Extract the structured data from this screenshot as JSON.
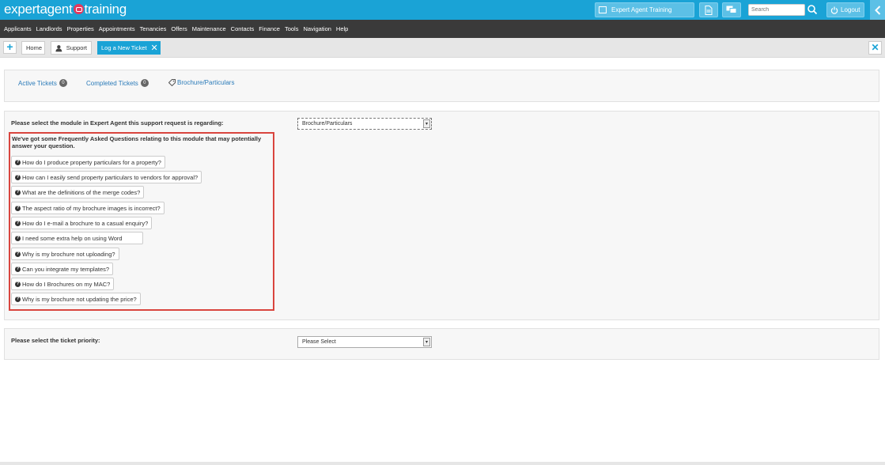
{
  "brand": {
    "logo_left": "expertagent",
    "logo_right": "training",
    "color": "#1aa3d6",
    "accent": "#e2385d"
  },
  "topbar": {
    "site_label": "Expert Agent Training",
    "search_placeholder": "Search",
    "logout_label": "Logout"
  },
  "nav": {
    "items": [
      "Applicants",
      "Landlords",
      "Properties",
      "Appointments",
      "Tenancies",
      "Offers",
      "Maintenance",
      "Contacts",
      "Finance",
      "Tools",
      "Navigation",
      "Help"
    ]
  },
  "tabs": {
    "home": "Home",
    "support": "Support",
    "active": "Log a New Ticket"
  },
  "subtabs": {
    "active_tickets": "Active Tickets",
    "active_count": "0",
    "completed_tickets": "Completed Tickets",
    "completed_count": "0",
    "brochure": "Brochure/Particulars"
  },
  "module": {
    "label": "Please select the module in Expert Agent this support request is regarding:",
    "selected": "Brochure/Particulars"
  },
  "faq": {
    "intro": "We've got some Frequently Asked Questions relating to this module that may potentially answer your question.",
    "questions": [
      "How do I produce property particulars for a property?",
      "How can I easily send property particulars to vendors for approval?",
      "What are the definitions of the merge codes?",
      "The aspect ratio of my brochure images is incorrect?",
      "How do I e-mail a brochure to a casual enquiry?",
      "I need some extra help on using Word",
      "Why is my brochure not uploading?",
      "Can you integrate my templates?",
      "How do I Brochures on my MAC?",
      "Why is my brochure not updating the price?"
    ],
    "highlight_color": "#d9453e"
  },
  "priority": {
    "label": "Please select the ticket priority:",
    "selected": "Please Select"
  }
}
